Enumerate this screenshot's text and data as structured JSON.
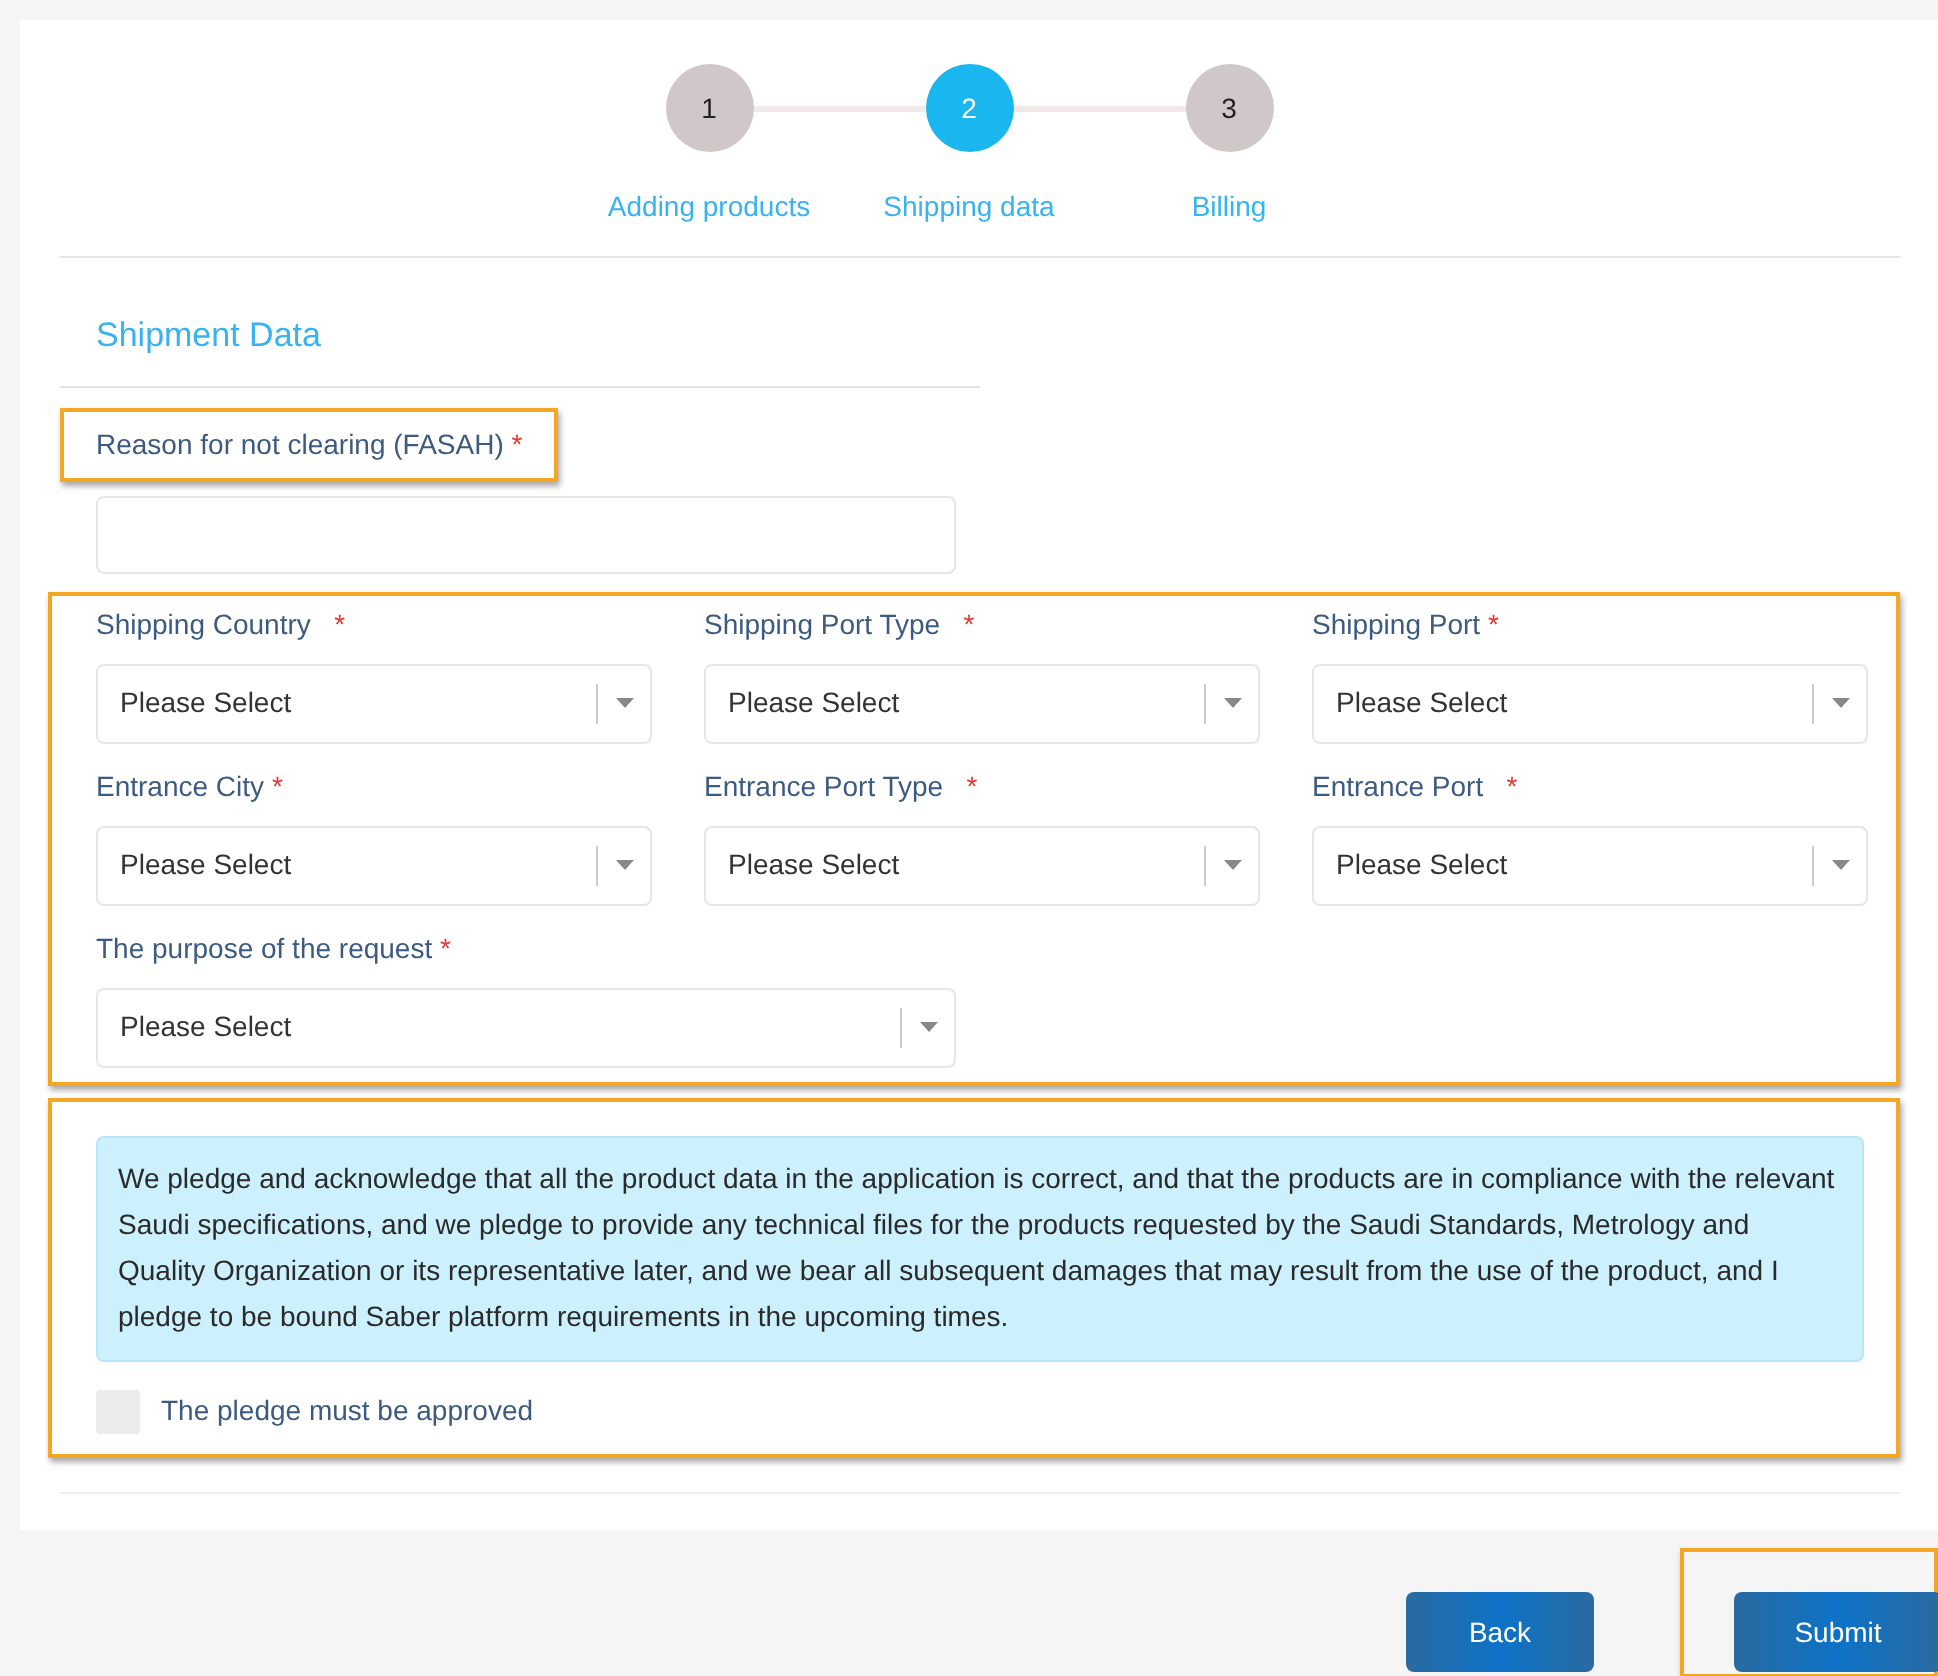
{
  "steps": [
    {
      "number": "1",
      "label": "Adding products",
      "selected": false
    },
    {
      "number": "2",
      "label": "Shipping data",
      "selected": true
    },
    {
      "number": "3",
      "label": "Billing",
      "selected": false
    }
  ],
  "section_title": "Shipment Data",
  "reason_field": {
    "label": "Reason for not clearing (FASAH)",
    "required_mark": "*",
    "highlighted": true
  },
  "shipping_fields": {
    "highlighted": true,
    "fields": [
      {
        "label": "Shipping Country",
        "required_mark": "*",
        "placeholder": "Please Select"
      },
      {
        "label": "Shipping Port Type",
        "required_mark": "*",
        "placeholder": "Please Select"
      },
      {
        "label": "Shipping Port",
        "required_mark": "*",
        "placeholder": "Please Select"
      },
      {
        "label": "Entrance City",
        "required_mark": "*",
        "placeholder": "Please Select"
      },
      {
        "label": "Entrance Port Type",
        "required_mark": "*",
        "placeholder": "Please Select"
      },
      {
        "label": "Entrance Port",
        "required_mark": "*",
        "placeholder": "Please Select"
      },
      {
        "label": "The purpose of the request",
        "required_mark": "*",
        "placeholder": "Please Select"
      }
    ]
  },
  "pledge": {
    "highlighted": true,
    "text": "We pledge and acknowledge that all the product data in the application is correct, and that the products are in compliance with the relevant Saudi specifications, and we pledge to provide any technical files for the products requested by the Saudi Standards, Metrology and Quality Organization or its representative later, and we bear all subsequent damages that may result from the use of the product, and I pledge to be bound Saber platform requirements in the upcoming times.",
    "checkbox_label": "The pledge must be approved",
    "checked": false
  },
  "buttons": [
    {
      "label": "Back",
      "highlighted": false
    },
    {
      "label": "Submit",
      "highlighted": true
    }
  ]
}
